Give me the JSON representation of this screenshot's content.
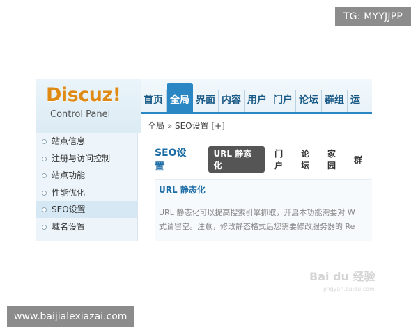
{
  "watermark_top": "TG: MYYJJPP",
  "watermark_bottom": "www.baijialexiazai.com",
  "logo": {
    "title": "Discuz!",
    "subtitle": "Control Panel"
  },
  "nav": {
    "items": [
      {
        "label": "首页",
        "active": false
      },
      {
        "label": "全局",
        "active": true
      },
      {
        "label": "界面",
        "active": false
      },
      {
        "label": "内容",
        "active": false
      },
      {
        "label": "用户",
        "active": false
      },
      {
        "label": "门户",
        "active": false
      },
      {
        "label": "论坛",
        "active": false
      },
      {
        "label": "群组",
        "active": false
      },
      {
        "label": "运",
        "active": false
      }
    ]
  },
  "breadcrumb": "全局 » SEO设置 [+]",
  "sidebar": {
    "items": [
      {
        "label": "站点信息",
        "active": false
      },
      {
        "label": "注册与访问控制",
        "active": false
      },
      {
        "label": "站点功能",
        "active": false
      },
      {
        "label": "性能优化",
        "active": false
      },
      {
        "label": "SEO设置",
        "active": true
      },
      {
        "label": "域名设置",
        "active": false
      }
    ]
  },
  "main": {
    "section_title": "SEO设置",
    "tabs": [
      {
        "label": "URL 静态化",
        "active": true
      },
      {
        "label": "门户",
        "active": false
      },
      {
        "label": "论坛",
        "active": false
      },
      {
        "label": "家园",
        "active": false
      },
      {
        "label": "群",
        "active": false
      }
    ],
    "content_heading": "URL 静态化",
    "desc_line1": "URL 静态化可以提高搜索引擎抓取，开启本功能需要对  W",
    "desc_line2": "式请留空。注意，修改静态格式后您需要修改服务器的  Re"
  },
  "baidu_watermark": "Bai du 经验",
  "baidu_watermark_sub": "jingyan.baidu.com"
}
